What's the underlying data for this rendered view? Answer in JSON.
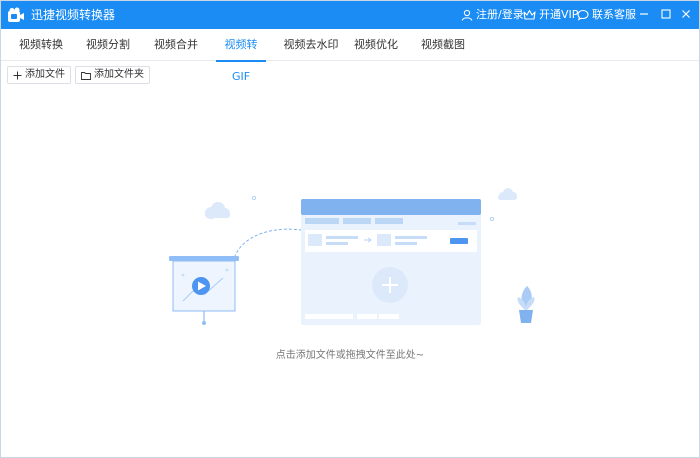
{
  "window": {
    "title": "迅捷视频转换器",
    "actions": {
      "login": "注册/登录",
      "vip": "开通VIP",
      "service": "联系客服"
    }
  },
  "tabs": [
    {
      "label": "视频转换"
    },
    {
      "label": "视频分割"
    },
    {
      "label": "视频合并"
    },
    {
      "label": "视频转GIF",
      "active": true
    },
    {
      "label": "视频去水印"
    },
    {
      "label": "视频优化"
    },
    {
      "label": "视频截图"
    }
  ],
  "toolbar": {
    "add_file": "添加文件",
    "add_folder": "添加文件夹"
  },
  "content": {
    "hint": "点击添加文件或拖拽文件至此处~"
  },
  "colors": {
    "primary": "#1a8cf3",
    "illustration_light": "#dbe9fb",
    "illustration_mid": "#a9cbf5"
  }
}
